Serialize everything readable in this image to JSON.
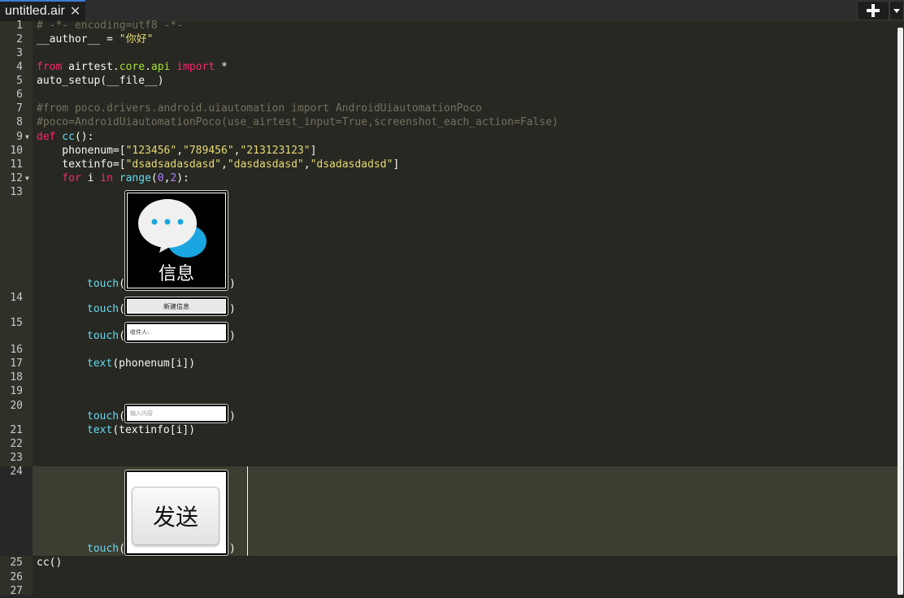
{
  "tab": {
    "title": "untitled.air",
    "close_glyph": "✕"
  },
  "toolbar": {
    "add_icon": "plus-icon",
    "menu_icon": "chevron-down-icon"
  },
  "line_numbers": [
    "1",
    "2",
    "3",
    "4",
    "5",
    "6",
    "7",
    "8",
    "9",
    "10",
    "11",
    "12",
    "13",
    "14",
    "15",
    "16",
    "17",
    "18",
    "19",
    "20",
    "21",
    "22",
    "23",
    "24",
    "25",
    "26",
    "27"
  ],
  "code": {
    "l1": "# -*- encoding=utf8 -*-",
    "l2_name": "__author__",
    "l2_eq": " = ",
    "l2_val": "\"你好\"",
    "l4_from": "from",
    "l4_mod1": " airtest.",
    "l4_mod2": "core",
    "l4_mod3": ".",
    "l4_mod4": "api",
    "l4_import": " import",
    "l4_star": " *",
    "l5": "auto_setup(__file__)",
    "l7": "#from poco.drivers.android.uiautomation import AndroidUiautomationPoco",
    "l8": "#poco=AndroidUiautomationPoco(use_airtest_input=True,screenshot_each_action=False)",
    "l9_def": "def",
    "l9_name": " cc",
    "l9_rest": "():",
    "l10_var": "    phonenum=[",
    "l10_s1": "\"123456\"",
    "l10_c1": ",",
    "l10_s2": "\"789456\"",
    "l10_c2": ",",
    "l10_s3": "\"213123123\"",
    "l10_end": "]",
    "l11_var": "    textinfo=[",
    "l11_s1": "\"dsadsadasdasd\"",
    "l11_c1": ",",
    "l11_s2": "\"dasdasdasd\"",
    "l11_c2": ",",
    "l11_s3": "\"dsadasdadsd\"",
    "l11_end": "]",
    "l12_for": "    for",
    "l12_i": " i ",
    "l12_in": "in",
    "l12_range": " range",
    "l12_p1": "(",
    "l12_n0": "0",
    "l12_cm": ",",
    "l12_n2": "2",
    "l12_p2": "):",
    "touch_fn": "touch",
    "paren_open": "(",
    "paren_close": ")",
    "text_fn": "text",
    "l17_arg": "(phonenum[i])",
    "l21_arg": "(textinfo[i])",
    "l25": "cc()"
  },
  "images": {
    "messages_label": "信息",
    "new_message_label": "新建信息",
    "recipient_label": "收件人:",
    "content_placeholder": "输入内容",
    "send_label": "发送"
  },
  "colors": {
    "background": "#272822",
    "keyword": "#f92672",
    "function": "#66d9ef",
    "string": "#e6db74",
    "number": "#ae81ff",
    "comment": "#75715e",
    "accent": "#3c7bd6"
  }
}
